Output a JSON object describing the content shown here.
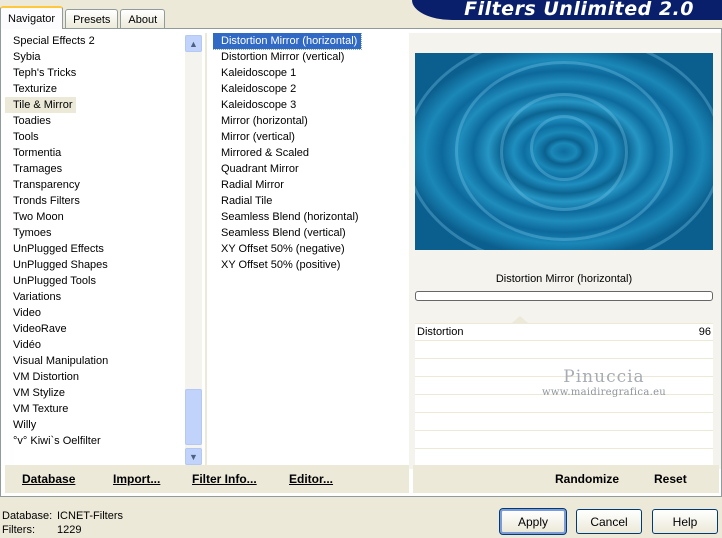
{
  "tabs": [
    {
      "label": "Navigator",
      "active": true
    },
    {
      "label": "Presets",
      "active": false
    },
    {
      "label": "About",
      "active": false
    }
  ],
  "brand_title": "Filters Unlimited 2.0",
  "categories": [
    {
      "label": "Special Effects 2",
      "selected": false
    },
    {
      "label": "Sybia",
      "selected": false
    },
    {
      "label": "Teph's Tricks",
      "selected": false
    },
    {
      "label": "Texturize",
      "selected": false
    },
    {
      "label": "Tile & Mirror",
      "selected": true
    },
    {
      "label": "Toadies",
      "selected": false
    },
    {
      "label": "Tools",
      "selected": false
    },
    {
      "label": "Tormentia",
      "selected": false
    },
    {
      "label": "Tramages",
      "selected": false
    },
    {
      "label": "Transparency",
      "selected": false
    },
    {
      "label": "Tronds Filters",
      "selected": false
    },
    {
      "label": "Two Moon",
      "selected": false
    },
    {
      "label": "Tymoes",
      "selected": false
    },
    {
      "label": "UnPlugged Effects",
      "selected": false
    },
    {
      "label": "UnPlugged Shapes",
      "selected": false
    },
    {
      "label": "UnPlugged Tools",
      "selected": false
    },
    {
      "label": "Variations",
      "selected": false
    },
    {
      "label": "Video",
      "selected": false
    },
    {
      "label": "VideoRave",
      "selected": false
    },
    {
      "label": "Vidéo",
      "selected": false
    },
    {
      "label": "Visual Manipulation",
      "selected": false
    },
    {
      "label": "VM Distortion",
      "selected": false
    },
    {
      "label": "VM Stylize",
      "selected": false
    },
    {
      "label": "VM Texture",
      "selected": false
    },
    {
      "label": "Willy",
      "selected": false
    },
    {
      "label": "°v° Kiwi`s Oelfilter",
      "selected": false
    }
  ],
  "filters": [
    {
      "label": "Distortion Mirror (horizontal)",
      "selected": true
    },
    {
      "label": "Distortion Mirror (vertical)",
      "selected": false
    },
    {
      "label": "Kaleidoscope 1",
      "selected": false
    },
    {
      "label": "Kaleidoscope 2",
      "selected": false
    },
    {
      "label": "Kaleidoscope 3",
      "selected": false
    },
    {
      "label": "Mirror (horizontal)",
      "selected": false
    },
    {
      "label": "Mirror (vertical)",
      "selected": false
    },
    {
      "label": "Mirrored & Scaled",
      "selected": false
    },
    {
      "label": "Quadrant Mirror",
      "selected": false
    },
    {
      "label": "Radial Mirror",
      "selected": false
    },
    {
      "label": "Radial Tile",
      "selected": false
    },
    {
      "label": "Seamless Blend (horizontal)",
      "selected": false
    },
    {
      "label": "Seamless Blend (vertical)",
      "selected": false
    },
    {
      "label": "XY Offset 50% (negative)",
      "selected": false
    },
    {
      "label": "XY Offset 50% (positive)",
      "selected": false
    }
  ],
  "preview": {
    "filter_name": "Distortion Mirror (horizontal)",
    "colors": {
      "base": "#0b5f8e",
      "light": "#2696c4"
    }
  },
  "params": [
    {
      "name": "Distortion",
      "value": "96"
    }
  ],
  "watermark": {
    "line1": "Pinuccia",
    "line2": "www.maidiregrafica.eu"
  },
  "toolbar": {
    "database": "Database",
    "import": "Import...",
    "filter_info": "Filter Info...",
    "editor": "Editor...",
    "randomize": "Randomize",
    "reset": "Reset"
  },
  "footer": {
    "database_label": "Database:",
    "database_value": "ICNET-Filters",
    "filters_label": "Filters:",
    "filters_value": "1229"
  },
  "buttons": {
    "apply": "Apply",
    "cancel": "Cancel",
    "help": "Help"
  }
}
